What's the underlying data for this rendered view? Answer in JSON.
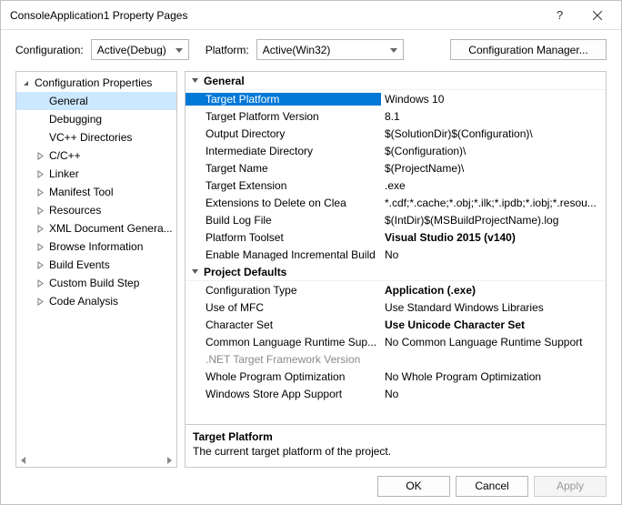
{
  "window": {
    "title": "ConsoleApplication1 Property Pages"
  },
  "cfgRow": {
    "configLabel": "Configuration:",
    "configValue": "Active(Debug)",
    "platformLabel": "Platform:",
    "platformValue": "Active(Win32)",
    "managerBtn": "Configuration Manager..."
  },
  "tree": {
    "root": "Configuration Properties",
    "items": [
      {
        "label": "General",
        "expandable": false,
        "selected": true
      },
      {
        "label": "Debugging",
        "expandable": false
      },
      {
        "label": "VC++ Directories",
        "expandable": false
      },
      {
        "label": "C/C++",
        "expandable": true
      },
      {
        "label": "Linker",
        "expandable": true
      },
      {
        "label": "Manifest Tool",
        "expandable": true
      },
      {
        "label": "Resources",
        "expandable": true
      },
      {
        "label": "XML Document Genera...",
        "expandable": true
      },
      {
        "label": "Browse Information",
        "expandable": true
      },
      {
        "label": "Build Events",
        "expandable": true
      },
      {
        "label": "Custom Build Step",
        "expandable": true
      },
      {
        "label": "Code Analysis",
        "expandable": true
      }
    ]
  },
  "grid": {
    "cats": [
      {
        "name": "General",
        "props": [
          {
            "name": "Target Platform",
            "value": "Windows 10",
            "selected": true
          },
          {
            "name": "Target Platform Version",
            "value": "8.1"
          },
          {
            "name": "Output Directory",
            "value": "$(SolutionDir)$(Configuration)\\"
          },
          {
            "name": "Intermediate Directory",
            "value": "$(Configuration)\\"
          },
          {
            "name": "Target Name",
            "value": "$(ProjectName)\\"
          },
          {
            "name": "Target Extension",
            "value": ".exe"
          },
          {
            "name": "Extensions to Delete on Clea",
            "value": "*.cdf;*.cache;*.obj;*.ilk;*.ipdb;*.iobj;*.resou..."
          },
          {
            "name": "Build Log File",
            "value": "$(IntDir)$(MSBuildProjectName).log"
          },
          {
            "name": "Platform Toolset",
            "value": "Visual Studio 2015 (v140)",
            "bold": true
          },
          {
            "name": "Enable Managed Incremental Build",
            "value": "No"
          }
        ]
      },
      {
        "name": "Project Defaults",
        "props": [
          {
            "name": "Configuration Type",
            "value": "Application (.exe)",
            "bold": true
          },
          {
            "name": "Use of MFC",
            "value": "Use Standard Windows Libraries"
          },
          {
            "name": "Character Set",
            "value": "Use Unicode Character Set",
            "bold": true
          },
          {
            "name": "Common Language Runtime Sup...",
            "value": "No Common Language Runtime Support"
          },
          {
            "name": ".NET Target Framework Version",
            "value": "",
            "disabled": true
          },
          {
            "name": "Whole Program Optimization",
            "value": "No Whole Program Optimization"
          },
          {
            "name": "Windows Store App Support",
            "value": "No"
          }
        ]
      }
    ]
  },
  "help": {
    "title": "Target Platform",
    "desc": "The current target platform of the project."
  },
  "footer": {
    "ok": "OK",
    "cancel": "Cancel",
    "apply": "Apply"
  }
}
